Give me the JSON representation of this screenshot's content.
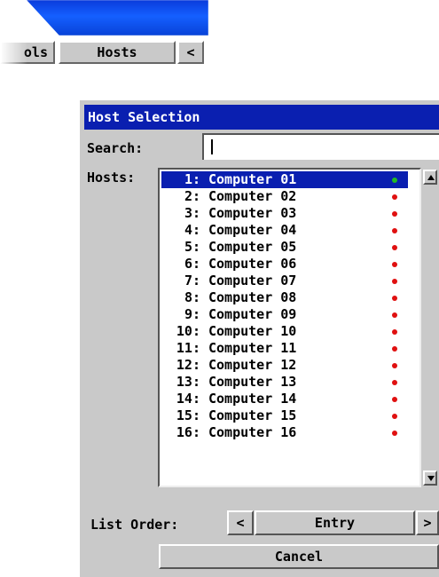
{
  "main_window": {
    "tabs": [
      {
        "label": "ols"
      },
      {
        "label": "Hosts"
      },
      {
        "label": "<"
      }
    ]
  },
  "dialog": {
    "title": "Host Selection",
    "search_label": "Search:",
    "search_value": "",
    "hosts_label": "Hosts:",
    "hosts": [
      {
        "num": "1:",
        "name": "Computer 01",
        "status": "online",
        "selected": true
      },
      {
        "num": "2:",
        "name": "Computer 02",
        "status": "offline",
        "selected": false
      },
      {
        "num": "3:",
        "name": "Computer 03",
        "status": "offline",
        "selected": false
      },
      {
        "num": "4:",
        "name": "Computer 04",
        "status": "offline",
        "selected": false
      },
      {
        "num": "5:",
        "name": "Computer 05",
        "status": "offline",
        "selected": false
      },
      {
        "num": "6:",
        "name": "Computer 06",
        "status": "offline",
        "selected": false
      },
      {
        "num": "7:",
        "name": "Computer 07",
        "status": "offline",
        "selected": false
      },
      {
        "num": "8:",
        "name": "Computer 08",
        "status": "offline",
        "selected": false
      },
      {
        "num": "9:",
        "name": "Computer 09",
        "status": "offline",
        "selected": false
      },
      {
        "num": "10:",
        "name": "Computer 10",
        "status": "offline",
        "selected": false
      },
      {
        "num": "11:",
        "name": "Computer 11",
        "status": "offline",
        "selected": false
      },
      {
        "num": "12:",
        "name": "Computer 12",
        "status": "offline",
        "selected": false
      },
      {
        "num": "13:",
        "name": "Computer 13",
        "status": "offline",
        "selected": false
      },
      {
        "num": "14:",
        "name": "Computer 14",
        "status": "offline",
        "selected": false
      },
      {
        "num": "15:",
        "name": "Computer 15",
        "status": "offline",
        "selected": false
      },
      {
        "num": "16:",
        "name": "Computer 16",
        "status": "offline",
        "selected": false
      }
    ],
    "list_order_label": "List Order:",
    "list_order_prev": "<",
    "list_order_value": "Entry",
    "list_order_next": ">",
    "cancel_label": "Cancel"
  },
  "colors": {
    "online": "#22bb22",
    "offline": "#e01010",
    "selection": "#0a1fb0"
  },
  "icons": {
    "scroll_up": "triangle-up-icon",
    "scroll_down": "triangle-down-icon"
  }
}
